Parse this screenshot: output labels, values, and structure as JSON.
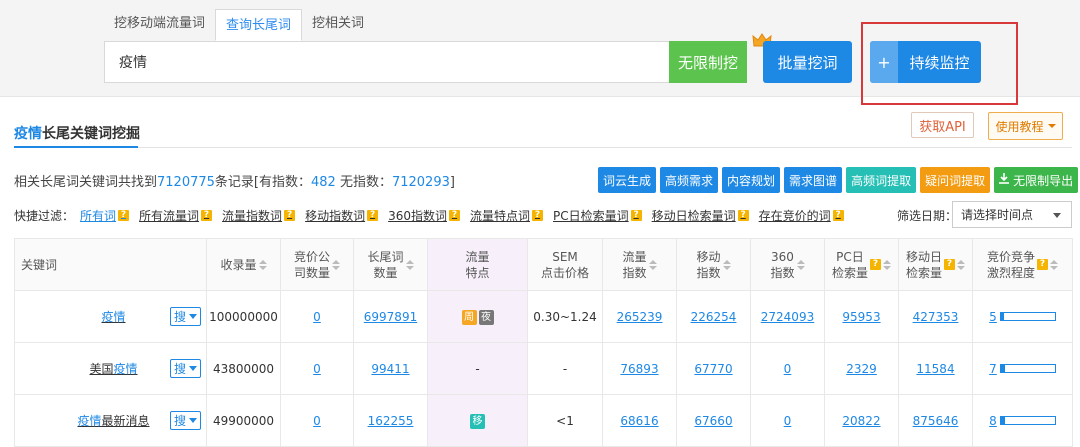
{
  "tabs": [
    {
      "label": "挖移动端流量词",
      "active": false
    },
    {
      "label": "查询长尾词",
      "active": true
    },
    {
      "label": "挖相关词",
      "active": false
    }
  ],
  "search": {
    "value": "疫情",
    "unlimited_label": "无限制挖"
  },
  "batch_label": "批量挖词",
  "monitor": {
    "plus": "+",
    "label": "持续监控"
  },
  "section": {
    "keyword": "疫情",
    "title_rest": "长尾关键词挖掘",
    "api_label": "获取API",
    "tutorial_label": "使用教程"
  },
  "summary": {
    "prefix": "相关长尾词关键词共找到",
    "total": "7120775",
    "mid1": "条记录[有指数：",
    "with_index": "482",
    "mid2": " 无指数：",
    "without_index": "7120293",
    "suffix": "]"
  },
  "actions": [
    {
      "label": "词云生成",
      "color": "blue"
    },
    {
      "label": "高频需求",
      "color": "blue"
    },
    {
      "label": "内容规划",
      "color": "blue"
    },
    {
      "label": "需求图谱",
      "color": "blue"
    },
    {
      "label": "高频词提取",
      "color": "teal"
    },
    {
      "label": "疑问词提取",
      "color": "orange"
    },
    {
      "label": "无限制导出",
      "color": "green"
    }
  ],
  "filters": {
    "lead": "快捷过滤：",
    "items": [
      {
        "label": "所有词",
        "active": true
      },
      {
        "label": "所有流量词",
        "active": false
      },
      {
        "label": "流量指数词",
        "active": false
      },
      {
        "label": "移动指数词",
        "active": false
      },
      {
        "label": "360指数词",
        "active": false
      },
      {
        "label": "流量特点词",
        "active": false
      },
      {
        "label": "PC日检索量词",
        "active": false
      },
      {
        "label": "移动日检索量词",
        "active": false
      },
      {
        "label": "存在竞价的词",
        "active": false
      }
    ],
    "help_glyph": "?",
    "date_label": "筛选日期：",
    "date_placeholder": "请选择时间点"
  },
  "table": {
    "headers": {
      "keyword": "关键词",
      "records": "收录量",
      "bid_companies_1": "竞价公",
      "bid_companies_2": "司数量",
      "longtail_1": "长尾词",
      "longtail_2": "数量",
      "traffic_1": "流量",
      "traffic_2": "特点",
      "sem_1": "SEM",
      "sem_2": "点击价格",
      "flow_1": "流量",
      "flow_2": "指数",
      "mobile_1": "移动",
      "mobile_2": "指数",
      "s360_1": "360",
      "s360_2": "指数",
      "pc_1": "PC日",
      "pc_2": "检索量",
      "mday_1": "移动日",
      "mday_2": "检索量",
      "comp_1": "竞价竞争",
      "comp_2": "激烈程度"
    },
    "search_label": "搜",
    "rows": [
      {
        "kw_prefix": "",
        "kw_hit": "疫情",
        "kw_suffix": "",
        "records": "100000000",
        "bid": "0",
        "longtail": "6997891",
        "badges": [
          "周",
          "夜"
        ],
        "sem": "0.30~1.24",
        "flow": "265239",
        "mobile": "226254",
        "s360": "2724093",
        "pc": "95953",
        "mday": "427353",
        "comp": "5",
        "comp_fraction": 0.05
      },
      {
        "kw_prefix": "美国",
        "kw_hit": "疫情",
        "kw_suffix": "",
        "records": "43800000",
        "bid": "0",
        "longtail": "99411",
        "traffic_text": "-",
        "sem": "-",
        "flow": "76893",
        "mobile": "67770",
        "s360": "0",
        "pc": "2329",
        "mday": "11584",
        "comp": "7",
        "comp_fraction": 0.07
      },
      {
        "kw_prefix": "",
        "kw_hit": "疫情",
        "kw_suffix": "最新消息",
        "records": "49900000",
        "bid": "0",
        "longtail": "162255",
        "badges": [
          "移"
        ],
        "sem": "<1",
        "flow": "68616",
        "mobile": "67660",
        "s360": "0",
        "pc": "20822",
        "mday": "875646",
        "comp": "8",
        "comp_fraction": 0.08
      }
    ]
  },
  "colors": {
    "accent": "#1e88e5",
    "green": "#5cc44e",
    "highlight": "#d9383a"
  }
}
